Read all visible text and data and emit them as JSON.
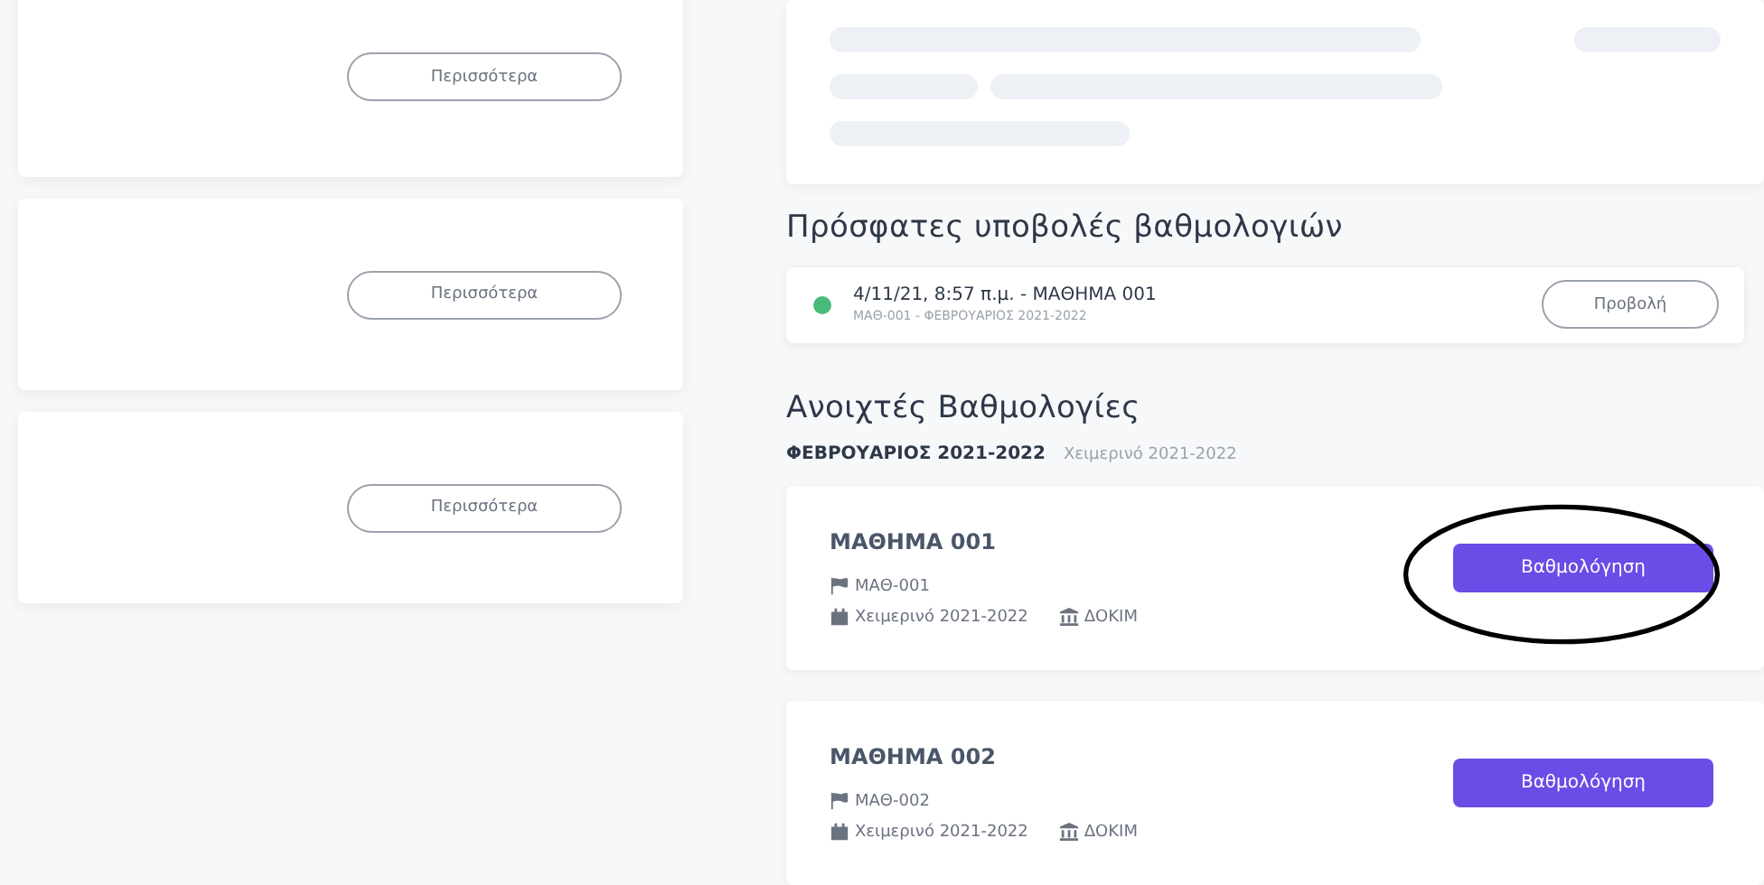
{
  "left_cards": [
    {
      "button": "Περισσότερα"
    },
    {
      "button": "Περισσότερα"
    },
    {
      "button": "Περισσότερα"
    }
  ],
  "recent_submissions": {
    "heading": "Πρόσφατες υποβολές βαθμολογιών",
    "items": [
      {
        "color": "#48bb78",
        "title": "4/11/21, 8:57 π.μ. - ΜΑΘΗΜΑ 001",
        "subtitle": "ΜΑΘ-001 - ΦΕΒΡΟΥΑΡΙΟΣ 2021-2022",
        "button": "Προβολή"
      }
    ]
  },
  "open_gradings": {
    "heading": "Ανοιχτές Βαθμολογίες",
    "period": "ΦΕΒΡΟΥΑΡΙΟΣ 2021-2022",
    "semester": "Χειμερινό 2021-2022",
    "courses": [
      {
        "title": "ΜΑΘΗΜΑ 001",
        "code": "ΜΑΘ-001",
        "semester": "Χειμερινό 2021-2022",
        "department": "ΔΟΚΙΜ",
        "button": "Βαθμολόγηση",
        "circled": true
      },
      {
        "title": "ΜΑΘΗΜΑ 002",
        "code": "ΜΑΘ-002",
        "semester": "Χειμερινό 2021-2022",
        "department": "ΔΟΚΙΜ",
        "button": "Βαθμολόγηση",
        "circled": false
      }
    ]
  }
}
